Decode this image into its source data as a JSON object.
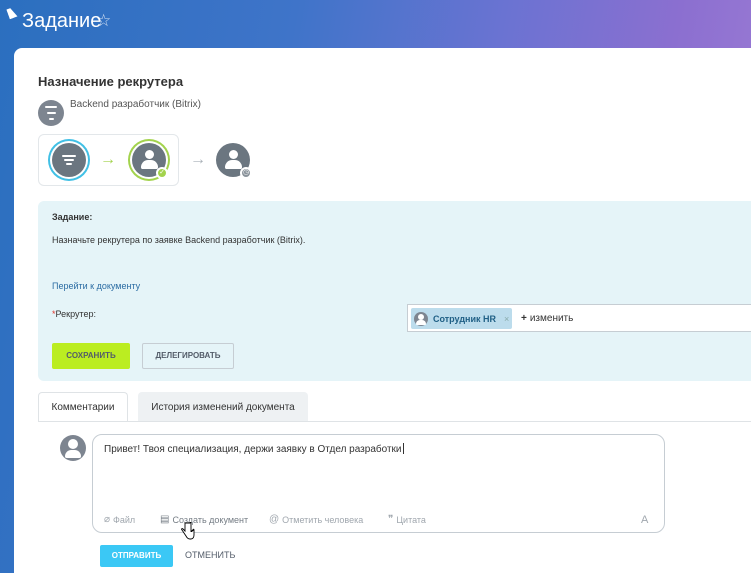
{
  "window": {
    "title": "Задание"
  },
  "workflow": {
    "title": "Назначение рекрутера",
    "subject": "Backend разработчик (Bitrix)"
  },
  "task": {
    "label": "Задание:",
    "description": "Назначьте рекрутера по заявке Backend разработчик (Bitrix).",
    "doc_link": "Перейти к документу",
    "recruiter_required_mark": "*",
    "recruiter_label": "Рекрутер:",
    "recruiter_value": "Сотрудник HR",
    "recruiter_remove": "×",
    "change_plus": "+",
    "change_label": "изменить",
    "save_label": "СОХРАНИТЬ",
    "delegate_label": "ДЕЛЕГИРОВАТЬ"
  },
  "tabs": [
    {
      "label": "Комментарии",
      "active": true
    },
    {
      "label": "История изменений документа",
      "active": false
    }
  ],
  "comment": {
    "text": "Привет! Твоя специализация, держи заявку в Отдел разработки",
    "tools": {
      "file": "Файл",
      "create_doc": "Создать документ",
      "mention": "Отметить человека",
      "quote": "Цитата",
      "font": "A"
    },
    "send_label": "ОТПРАВИТЬ",
    "cancel_label": "ОТМЕНИТЬ"
  },
  "colors": {
    "accent_green": "#bbed21",
    "accent_blue": "#3bc8f5",
    "panel_bg": "#e5f4f8"
  }
}
